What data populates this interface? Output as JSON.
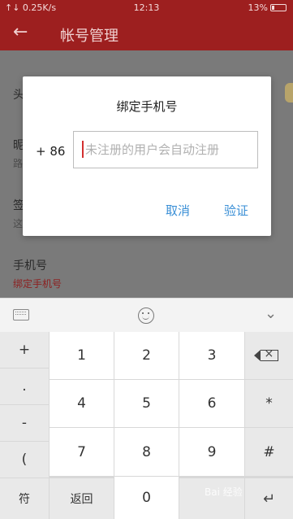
{
  "status_bar": {
    "left": "↑↓ 0.25K/s",
    "time": "12:13",
    "battery": "13%"
  },
  "app_bar": {
    "back_icon": "arrow-left-icon",
    "title": "帐号管理"
  },
  "page_rows": [
    {
      "label": "头",
      "sub": ""
    },
    {
      "label": "昵",
      "sub": "路"
    },
    {
      "label": "签",
      "sub": "这"
    },
    {
      "label": "手机号",
      "sub": "绑定手机号"
    }
  ],
  "dialog": {
    "title": "绑定手机号",
    "country_code": "+ 86",
    "phone_placeholder": "未注册的用户会自动注册",
    "phone_value": "",
    "cancel_label": "取消",
    "verify_label": "验证",
    "accent_color": "#3a8fd6"
  },
  "keyboard": {
    "toolbar_icons": [
      "keyboard-icon",
      "emoji-icon",
      "chevron-down-icon"
    ],
    "left_column": [
      "+",
      ".",
      "-",
      "("
    ],
    "right_column": [
      "backspace-icon",
      "*",
      "#",
      "enter-icon"
    ],
    "digits": [
      "1",
      "2",
      "3",
      "4",
      "5",
      "6",
      "7",
      "8",
      "9"
    ],
    "symbols_label": "符",
    "back_label": "返回",
    "zero_label": "0"
  },
  "watermark": "Bai 经验"
}
